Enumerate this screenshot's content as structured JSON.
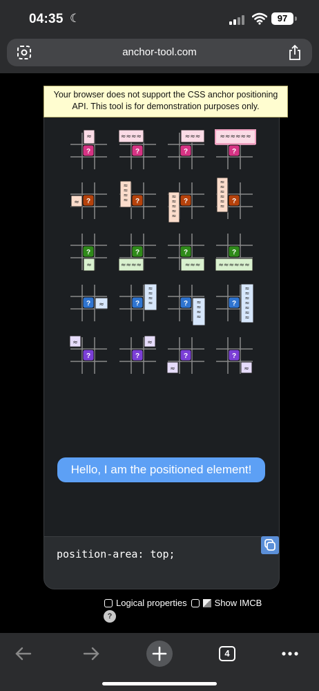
{
  "status_bar": {
    "time": "04:35",
    "battery": "97"
  },
  "browser": {
    "url": "anchor-tool.com"
  },
  "warning_text": "Your browser does not support the CSS anchor positioning API. This tool is for demonstration purposes only.",
  "demo": {
    "anchor_label": "?",
    "rows": [
      {
        "color": "#d63384",
        "light": "#fbdbe6"
      },
      {
        "color": "#b5420c",
        "light": "#fbdccb"
      },
      {
        "color": "#2f8a1a",
        "light": "#d9f1cf"
      },
      {
        "color": "#2f74d0",
        "light": "#d6e6fb"
      },
      {
        "color": "#7b3fd6",
        "light": "#e6dcfb"
      }
    ],
    "positioned_text": "Hello, I am the positioned element!"
  },
  "code": {
    "text": "position-area: top;"
  },
  "options": {
    "logical_label": "Logical properties",
    "imcb_label": "Show IMCB",
    "help": "?"
  },
  "toolbar": {
    "tab_count": "4"
  }
}
